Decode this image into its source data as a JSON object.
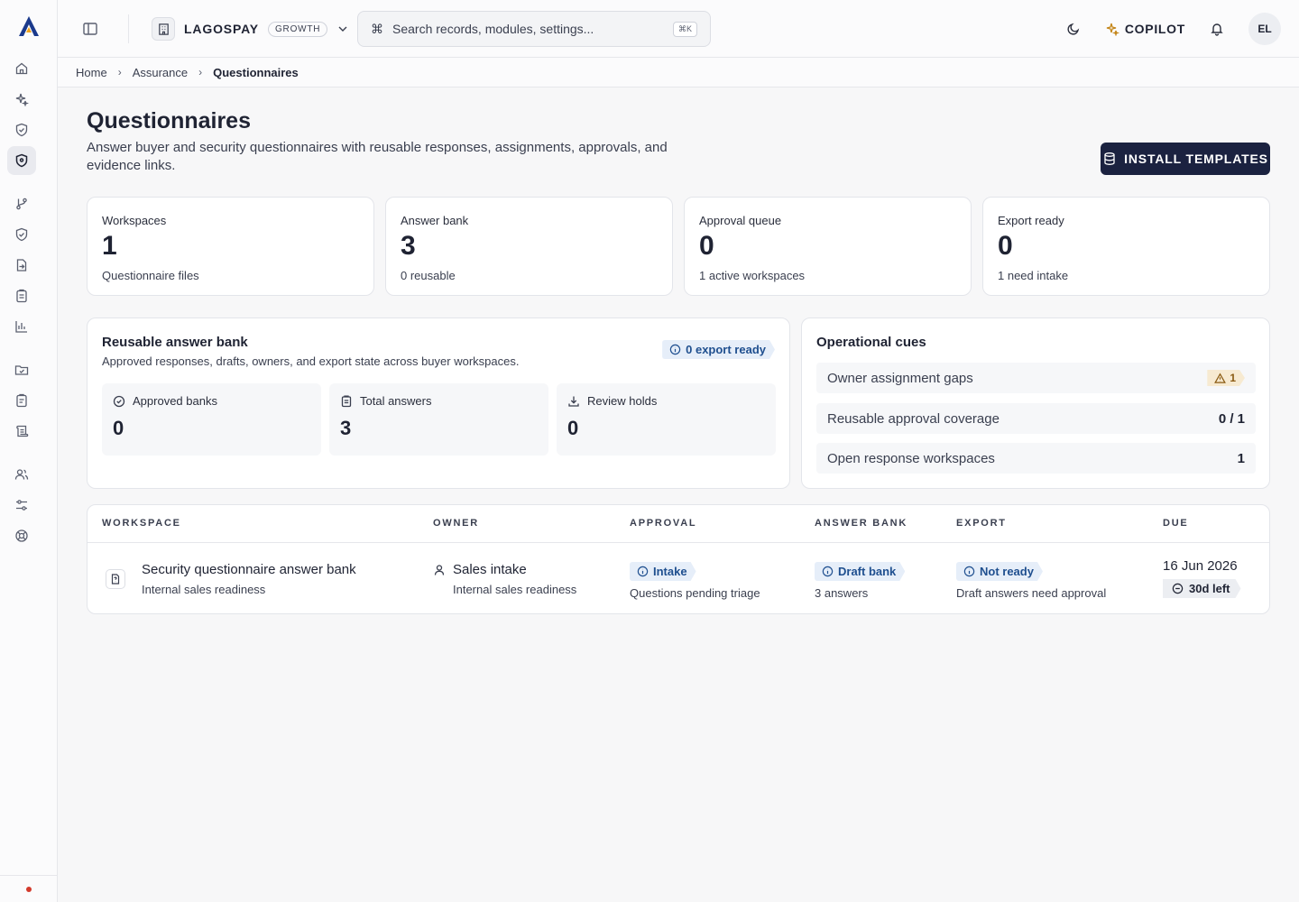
{
  "app": {
    "org_name": "LAGOSPAY",
    "plan": "GROWTH"
  },
  "topbar": {
    "search_placeholder": "Search records, modules, settings...",
    "search_shortcut": "⌘K",
    "copilot_label": "COPILOT",
    "avatar_initials": "EL"
  },
  "breadcrumb": {
    "items": [
      "Home",
      "Assurance",
      "Questionnaires"
    ]
  },
  "page": {
    "title": "Questionnaires",
    "description": "Answer buyer and security questionnaires with reusable responses, assignments, approvals, and evidence links.",
    "install_button": "INSTALL TEMPLATES"
  },
  "stats": [
    {
      "label": "Workspaces",
      "value": "1",
      "sub": "Questionnaire files"
    },
    {
      "label": "Answer bank",
      "value": "3",
      "sub": "0 reusable"
    },
    {
      "label": "Approval queue",
      "value": "0",
      "sub": "1 active workspaces"
    },
    {
      "label": "Export ready",
      "value": "0",
      "sub": "1 need intake"
    }
  ],
  "answer_bank": {
    "title": "Reusable answer bank",
    "description": "Approved responses, drafts, owners, and export state across buyer workspaces.",
    "badge": "0 export ready",
    "metrics": [
      {
        "label": "Approved banks",
        "value": "0",
        "icon": "check-circle-icon"
      },
      {
        "label": "Total answers",
        "value": "3",
        "icon": "clipboard-icon"
      },
      {
        "label": "Review holds",
        "value": "0",
        "icon": "download-icon"
      }
    ]
  },
  "cues": {
    "title": "Operational cues",
    "items": [
      {
        "label": "Owner assignment gaps",
        "value": "1"
      },
      {
        "label": "Reusable approval coverage",
        "value": "0 / 1"
      },
      {
        "label": "Open response workspaces",
        "value": "1"
      }
    ]
  },
  "table": {
    "columns": [
      "WORKSPACE",
      "OWNER",
      "APPROVAL",
      "ANSWER BANK",
      "EXPORT",
      "DUE"
    ],
    "rows": [
      {
        "workspace": "Security questionnaire answer bank",
        "workspace_sub": "Internal sales readiness",
        "owner": "Sales intake",
        "owner_sub": "Internal sales readiness",
        "approval": "Intake",
        "approval_sub": "Questions pending triage",
        "answer_bank": "Draft bank",
        "answer_bank_sub": "3 answers",
        "export": "Not ready",
        "export_sub": "Draft answers need approval",
        "due": "16 Jun 2026",
        "due_left": "30d left"
      }
    ]
  },
  "colors": {
    "primary": "#1b2240",
    "info_badge_bg": "#e6eef9",
    "warn_badge_bg": "#f7ead1",
    "status_dot": "#d33a2c"
  }
}
